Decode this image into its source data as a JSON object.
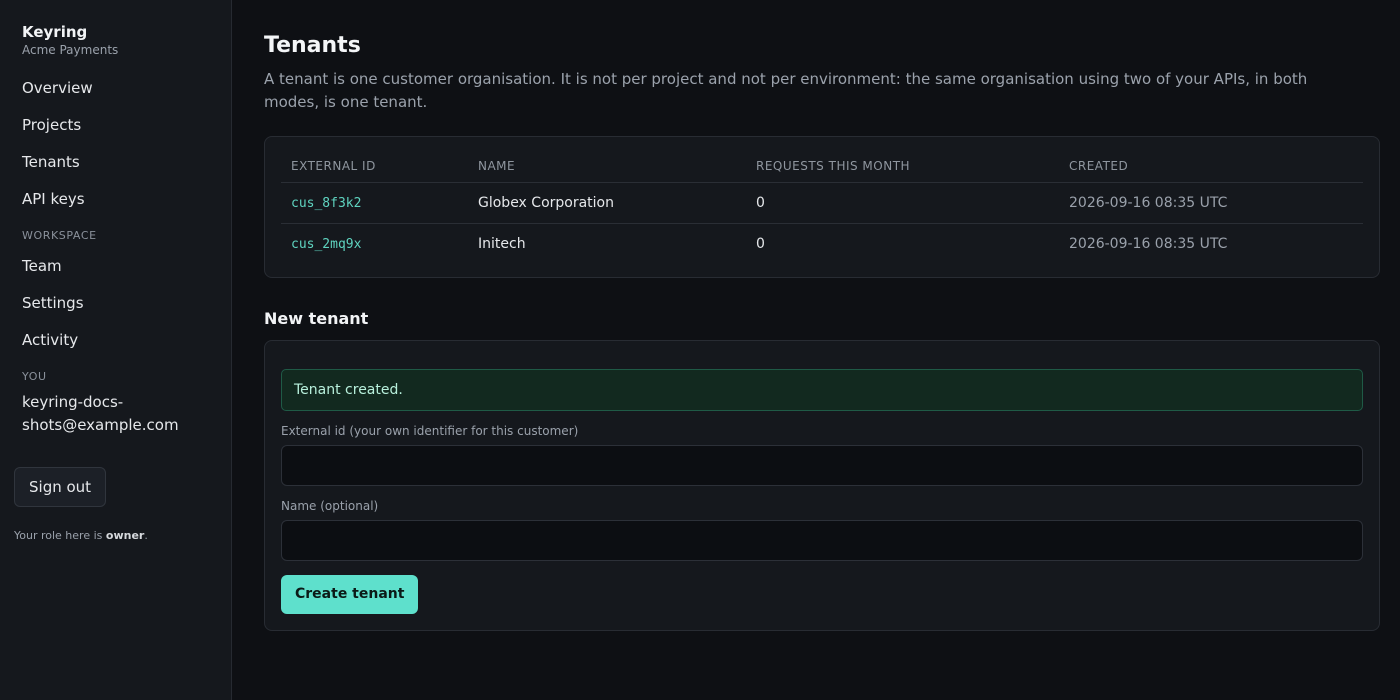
{
  "sidebar": {
    "brand_name": "Keyring",
    "brand_org": "Acme Payments",
    "nav": [
      {
        "label": "Overview"
      },
      {
        "label": "Projects"
      },
      {
        "label": "Tenants"
      },
      {
        "label": "API keys"
      }
    ],
    "workspace_heading": "WORKSPACE",
    "workspace_nav": [
      {
        "label": "Team"
      },
      {
        "label": "Settings"
      },
      {
        "label": "Activity"
      }
    ],
    "you_heading": "YOU",
    "user_email": "keyring-docs-shots@example.com",
    "signout_label": "Sign out",
    "role_prefix": "Your role here is",
    "role_value": "owner",
    "role_suffix": "."
  },
  "page": {
    "title": "Tenants",
    "description": "A tenant is one customer organisation. It is not per project and not per environment: the same organisation using two of your APIs, in both modes, is one tenant."
  },
  "tenants_table": {
    "headers": {
      "external_id": "EXTERNAL ID",
      "name": "NAME",
      "requests": "REQUESTS THIS MONTH",
      "created": "CREATED"
    },
    "rows": [
      {
        "external_id": "cus_8f3k2",
        "name": "Globex Corporation",
        "requests": "0",
        "created": "2026-09-16 08:35 UTC"
      },
      {
        "external_id": "cus_2mq9x",
        "name": "Initech",
        "requests": "0",
        "created": "2026-09-16 08:35 UTC"
      }
    ]
  },
  "new_tenant": {
    "title": "New tenant",
    "alert": "Tenant created.",
    "external_id_label": "External id (your own identifier for this customer)",
    "external_id_value": "",
    "name_label": "Name (optional)",
    "name_value": "",
    "submit_label": "Create tenant"
  },
  "colors": {
    "accent": "#5ee0cc",
    "mono_id": "#5fd4c0",
    "success_bg": "#12291f"
  }
}
